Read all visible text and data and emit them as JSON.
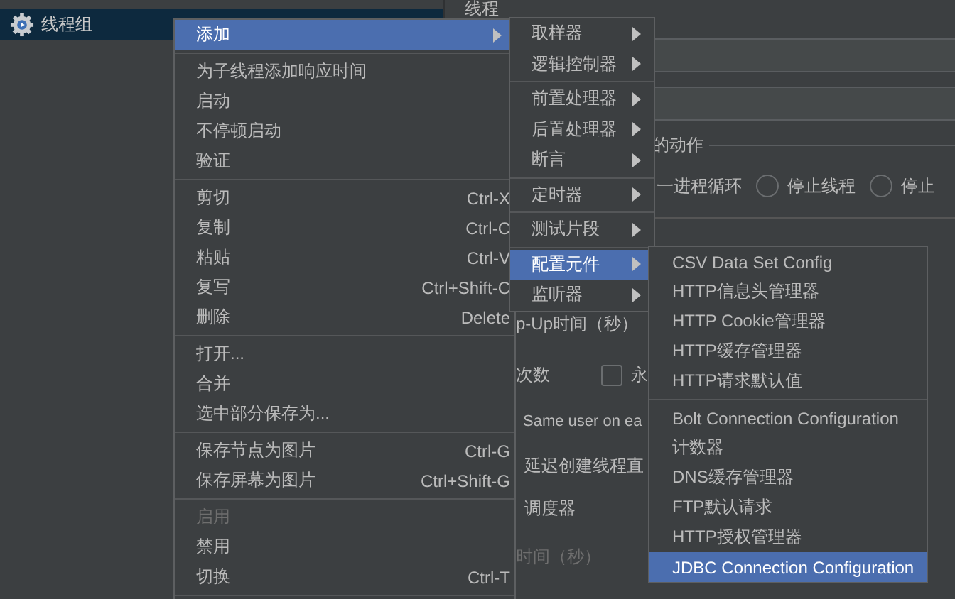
{
  "tree": {
    "items": [
      {
        "label": "线程组",
        "selected": true
      }
    ]
  },
  "panel": {
    "title": "线程",
    "action_legend": "的动作",
    "loop_text": "一进程循环",
    "radios": [
      {
        "label": "停止线程",
        "selected": false
      },
      {
        "label": "停止",
        "selected": false
      }
    ],
    "ramp_label": "p-Up时间（秒）",
    "loop_count": {
      "label": "次数",
      "forever_checked": false,
      "forever_label": "永"
    },
    "same_user": "Same user on ea",
    "delay_create": "延迟创建线程直",
    "scheduler": "调度器",
    "duration": {
      "label": "时间（秒）",
      "disabled": true
    }
  },
  "context_menu": {
    "items": [
      {
        "kind": "item",
        "label": "添加",
        "submenu": true,
        "selected": true,
        "disabled": false
      },
      {
        "kind": "separator"
      },
      {
        "kind": "item",
        "label": "为子线程添加响应时间",
        "submenu": false,
        "selected": false,
        "disabled": false
      },
      {
        "kind": "item",
        "label": "启动",
        "submenu": false,
        "selected": false,
        "disabled": false
      },
      {
        "kind": "item",
        "label": "不停顿启动",
        "submenu": false,
        "selected": false,
        "disabled": false
      },
      {
        "kind": "item",
        "label": "验证",
        "submenu": false,
        "selected": false,
        "disabled": false
      },
      {
        "kind": "separator"
      },
      {
        "kind": "item",
        "label": "剪切",
        "shortcut": "Ctrl-X",
        "submenu": false,
        "selected": false,
        "disabled": false
      },
      {
        "kind": "item",
        "label": "复制",
        "shortcut": "Ctrl-C",
        "submenu": false,
        "selected": false,
        "disabled": false
      },
      {
        "kind": "item",
        "label": "粘贴",
        "shortcut": "Ctrl-V",
        "submenu": false,
        "selected": false,
        "disabled": false
      },
      {
        "kind": "item",
        "label": "复写",
        "shortcut": "Ctrl+Shift-C",
        "submenu": false,
        "selected": false,
        "disabled": false
      },
      {
        "kind": "item",
        "label": "删除",
        "shortcut": "Delete",
        "submenu": false,
        "selected": false,
        "disabled": false
      },
      {
        "kind": "separator"
      },
      {
        "kind": "item",
        "label": "打开...",
        "submenu": false,
        "selected": false,
        "disabled": false
      },
      {
        "kind": "item",
        "label": "合并",
        "submenu": false,
        "selected": false,
        "disabled": false
      },
      {
        "kind": "item",
        "label": "选中部分保存为...",
        "submenu": false,
        "selected": false,
        "disabled": false
      },
      {
        "kind": "separator"
      },
      {
        "kind": "item",
        "label": "保存节点为图片",
        "shortcut": "Ctrl-G",
        "submenu": false,
        "selected": false,
        "disabled": false
      },
      {
        "kind": "item",
        "label": "保存屏幕为图片",
        "shortcut": "Ctrl+Shift-G",
        "submenu": false,
        "selected": false,
        "disabled": false
      },
      {
        "kind": "separator"
      },
      {
        "kind": "item",
        "label": "启用",
        "submenu": false,
        "selected": false,
        "disabled": true
      },
      {
        "kind": "item",
        "label": "禁用",
        "submenu": false,
        "selected": false,
        "disabled": false
      },
      {
        "kind": "item",
        "label": "切换",
        "shortcut": "Ctrl-T",
        "submenu": false,
        "selected": false,
        "disabled": false
      },
      {
        "kind": "separator"
      }
    ]
  },
  "add_submenu": {
    "items": [
      {
        "kind": "item",
        "label": "取样器",
        "submenu": true,
        "selected": false
      },
      {
        "kind": "item",
        "label": "逻辑控制器",
        "submenu": true,
        "selected": false
      },
      {
        "kind": "separator"
      },
      {
        "kind": "item",
        "label": "前置处理器",
        "submenu": true,
        "selected": false
      },
      {
        "kind": "item",
        "label": "后置处理器",
        "submenu": true,
        "selected": false
      },
      {
        "kind": "item",
        "label": "断言",
        "submenu": true,
        "selected": false
      },
      {
        "kind": "separator"
      },
      {
        "kind": "item",
        "label": "定时器",
        "submenu": true,
        "selected": false
      },
      {
        "kind": "separator"
      },
      {
        "kind": "item",
        "label": "测试片段",
        "submenu": true,
        "selected": false
      },
      {
        "kind": "separator"
      },
      {
        "kind": "item",
        "label": "配置元件",
        "submenu": true,
        "selected": true
      },
      {
        "kind": "item",
        "label": "监听器",
        "submenu": true,
        "selected": false
      }
    ]
  },
  "config_submenu": {
    "items": [
      {
        "kind": "item",
        "label": "CSV Data Set Config",
        "selected": false
      },
      {
        "kind": "item",
        "label": "HTTP信息头管理器",
        "selected": false
      },
      {
        "kind": "item",
        "label": "HTTP Cookie管理器",
        "selected": false
      },
      {
        "kind": "item",
        "label": "HTTP缓存管理器",
        "selected": false
      },
      {
        "kind": "item",
        "label": "HTTP请求默认值",
        "selected": false
      },
      {
        "kind": "separator"
      },
      {
        "kind": "item",
        "label": "Bolt Connection Configuration",
        "selected": false
      },
      {
        "kind": "item",
        "label": "计数器",
        "selected": false
      },
      {
        "kind": "item",
        "label": "DNS缓存管理器",
        "selected": false
      },
      {
        "kind": "item",
        "label": "FTP默认请求",
        "selected": false
      },
      {
        "kind": "item",
        "label": "HTTP授权管理器",
        "selected": false
      },
      {
        "kind": "item",
        "label": "JDBC Connection Configuration",
        "selected": true
      }
    ]
  }
}
